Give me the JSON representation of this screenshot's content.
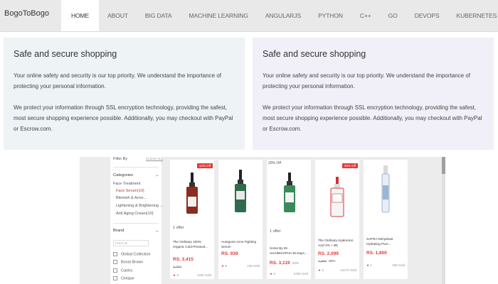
{
  "nav": {
    "brand": "BogoToBogo",
    "items": [
      "HOME",
      "ABOUT",
      "BIG DATA",
      "MACHINE LEARNING",
      "ANGULARJS",
      "PYTHON",
      "C++",
      "GO",
      "DEVOPS",
      "KUBERNETES"
    ],
    "active_index": 0
  },
  "boxes": [
    {
      "title": "Safe and secure shopping",
      "p1": "Your online safety and security is our top priority. We understand the importance of protecting your personal information.",
      "p2": "We protect your information through SSL encryption technology, providing the safest, most secure shopping experience possible. Additionally, you may checkout with PayPal or Escrow.com."
    },
    {
      "title": "Safe and secure shopping",
      "p1": "Your online safety and security is our top priority. We understand the importance of protecting your personal information.",
      "p2": "We protect your information through SSL encryption technology, providing the safest, most secure shopping experience possible. Additionally, you may checkout with PayPal or Escrow.com."
    }
  ],
  "shop": {
    "filter": {
      "top_label": "Filter By",
      "top_link": "CLEAR ALL",
      "categories_header": "Categories",
      "categories": [
        "Face Treatment",
        "Face Serum(10)",
        "Blemish & Acne...",
        "Lightening & Brightening ...",
        "Anti Aging Cream(10)"
      ],
      "brand_header": "Brand",
      "brand_search_placeholder": "Find A B",
      "brands": [
        "Global Collection",
        "Boost Brown",
        "Cantrs",
        "Cinique"
      ]
    },
    "products": [
      {
        "badge": "12% Off",
        "offer": "1 offer",
        "name": "The Ordinary 100% Organic Cold-Pressed...",
        "price": "RS. 3,415",
        "old_price": "3,794",
        "rating": "3",
        "sold": "1466 Sold",
        "accent": "#8a2d1e"
      },
      {
        "badge": "",
        "offer": "",
        "name": "Auregone Acne Fighting Serum",
        "price": "RS. 939",
        "old_price": "",
        "rating": "5",
        "sold": "238 Sold",
        "accent": "#2f6b4e"
      },
      {
        "badge": "",
        "top_text": "20% Off",
        "offer": "1 offer",
        "name": "Some By Mi AHA/BHA/PHA 30 Days...",
        "price": "RS. 3,119",
        "discount": "-22%",
        "old_price": "",
        "rating": "4",
        "sold": "2489 Sold",
        "accent": "#3a8a5a"
      },
      {
        "badge": "30% Off",
        "offer": "",
        "name": "The Ordinary Hyaluronic Acid 2% + B5",
        "price": "RS. 2,099",
        "old_price": "2,998",
        "old_discount": "-30%",
        "rating": "4",
        "sold": "15479 Sold",
        "accent": "#d33a3a"
      },
      {
        "badge": "",
        "offer": "",
        "name": "SAFRA Dehydrant Hydrating Pure...",
        "price": "RS. 1,800",
        "old_price": "",
        "rating": "1",
        "sold": "288 Sold",
        "accent": "#5b86b8"
      }
    ]
  }
}
